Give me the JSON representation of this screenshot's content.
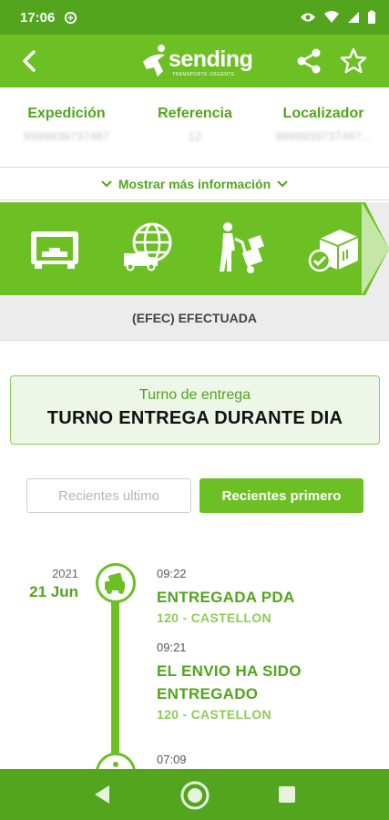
{
  "status_bar": {
    "time": "17:06"
  },
  "app_bar": {
    "logo_text": "sending",
    "logo_tagline": "TRANSPORTE URGENTE"
  },
  "info": {
    "columns": [
      {
        "label": "Expedición",
        "value": "9999939737487"
      },
      {
        "label": "Referencia",
        "value": "12"
      },
      {
        "label": "Localizador",
        "value": "9999939737487..."
      }
    ],
    "more_label": "Mostrar más información"
  },
  "status": {
    "text": "(EFEC) EFECTUADA"
  },
  "turno": {
    "label": "Turno de entrega",
    "value": "TURNO ENTREGA DURANTE DIA"
  },
  "sort": {
    "last_label": "Recientes ultimo",
    "first_label": "Recientes primero"
  },
  "timeline": {
    "year": "2021",
    "day": "21 Jun",
    "events": [
      {
        "time": "09:22",
        "title": "ENTREGADA PDA",
        "location": "120 - CASTELLON"
      },
      {
        "time": "09:21",
        "title": "EL ENVIO HA SIDO ENTREGADO",
        "location": "120 - CASTELLON"
      },
      {
        "time": "07:09",
        "title": "",
        "location": ""
      }
    ]
  },
  "colors": {
    "brand_green": "#6cc024",
    "dark_green": "#52a51d",
    "light_green_bg": "#eef6e7"
  },
  "icons": [
    "back-arrow-icon",
    "share-icon",
    "star-icon",
    "warehouse-icon",
    "globe-truck-icon",
    "hand-truck-icon",
    "delivered-box-icon"
  ]
}
